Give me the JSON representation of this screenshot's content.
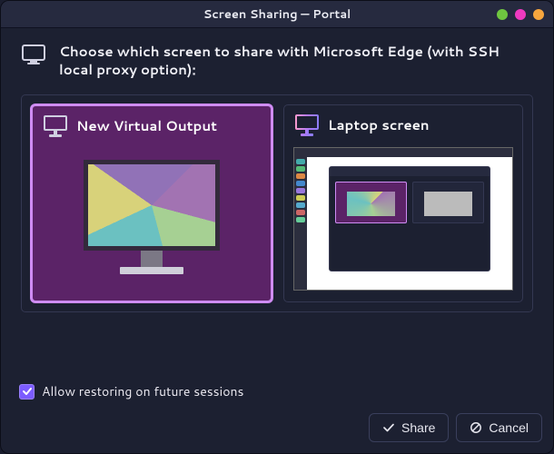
{
  "titlebar": {
    "title": "Screen Sharing — Portal"
  },
  "prompt": {
    "text": "Choose which screen to share with Microsoft Edge (with SSH local proxy option):"
  },
  "options": {
    "virtual": {
      "label": "New Virtual Output",
      "icon": "monitor-icon",
      "selected": true
    },
    "laptop": {
      "label": "Laptop screen",
      "icon": "monitor-gradient-icon",
      "selected": false
    }
  },
  "checkbox": {
    "label": "Allow restoring on future sessions",
    "checked": true
  },
  "actions": {
    "share_label": "Share",
    "cancel_label": "Cancel"
  },
  "colors": {
    "selected_bg": "#5b2367",
    "selected_border": "#cf8cf3",
    "accent": "#7c5cff"
  }
}
